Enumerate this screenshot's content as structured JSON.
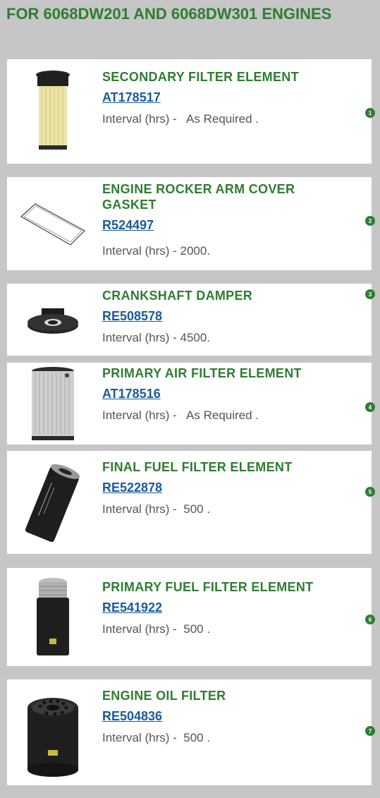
{
  "page": {
    "title": "FOR 6068DW201 AND 6068DW301 ENGINES"
  },
  "colors": {
    "accent_green": "#2f7d32",
    "link_blue": "#1a5a9e",
    "background": "#c6c6c6"
  },
  "items": [
    {
      "name": "SECONDARY FILTER ELEMENT",
      "part_number": "AT178517",
      "interval": "Interval (hrs) -   As Required .",
      "badge": "1",
      "icon": "secondary-filter-icon"
    },
    {
      "name": "ENGINE ROCKER ARM COVER GASKET",
      "part_number": "R524497",
      "interval": "Interval (hrs) - 2000.",
      "badge": "2",
      "icon": "gasket-icon"
    },
    {
      "name": "CRANKSHAFT DAMPER",
      "part_number": "RE508578",
      "interval": "Interval (hrs) - 4500.",
      "badge": "3",
      "icon": "damper-icon"
    },
    {
      "name": "PRIMARY AIR FILTER ELEMENT",
      "part_number": "AT178516",
      "interval": "Interval (hrs) -   As Required .",
      "badge": "4",
      "icon": "air-filter-icon"
    },
    {
      "name": "FINAL FUEL FILTER ELEMENT",
      "part_number": "RE522878",
      "interval": "Interval (hrs) -  500 .",
      "badge": "5",
      "icon": "final-fuel-filter-icon"
    },
    {
      "name": "PRIMARY FUEL FILTER ELEMENT",
      "part_number": "RE541922",
      "interval": "Interval (hrs) -  500 .",
      "badge": "6",
      "icon": "primary-fuel-filter-icon"
    },
    {
      "name": "ENGINE OIL FILTER",
      "part_number": "RE504836",
      "interval": "Interval (hrs) -  500 .",
      "badge": "7",
      "icon": "oil-filter-icon"
    }
  ]
}
